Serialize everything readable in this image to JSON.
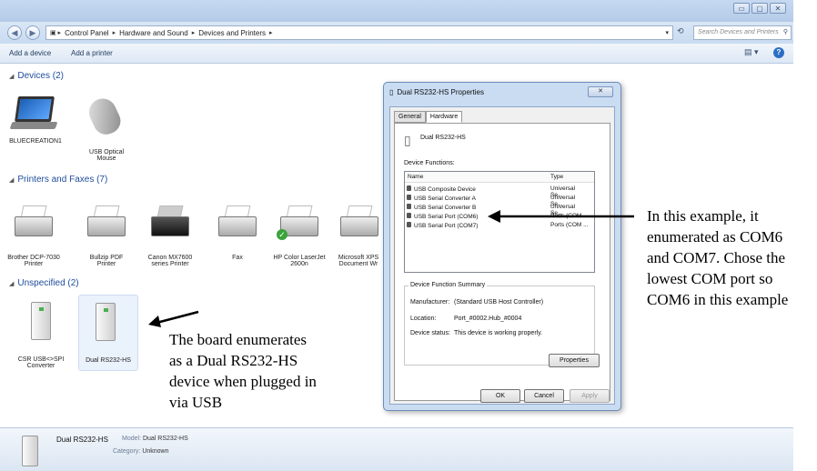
{
  "window": {
    "minimize": "▭",
    "maximize": "▢",
    "close": "✕"
  },
  "address": {
    "crumbs": [
      "Control Panel",
      "Hardware and Sound",
      "Devices and Printers"
    ],
    "search_placeholder": "Search Devices and Printers"
  },
  "toolbar": {
    "add_device": "Add a device",
    "add_printer": "Add a printer"
  },
  "sections": {
    "devices": "Devices (2)",
    "printers": "Printers and Faxes (7)",
    "unspecified": "Unspecified (2)"
  },
  "devices": [
    {
      "label": "BLUECREATION1",
      "icon": "laptop-icon"
    },
    {
      "label": "USB Optical Mouse",
      "icon": "mouse-icon"
    }
  ],
  "printers": [
    {
      "label": "Brother DCP-7030 Printer",
      "icon": "printer-icon"
    },
    {
      "label": "Bullzip PDF Printer",
      "icon": "printer-icon"
    },
    {
      "label": "Canon MX7600 series Printer",
      "icon": "printer-icon"
    },
    {
      "label": "Fax",
      "icon": "fax-icon"
    },
    {
      "label": "HP Color LaserJet 2600n",
      "icon": "printer-icon"
    },
    {
      "label": "Microsoft XPS Document Wr",
      "icon": "printer-icon"
    }
  ],
  "unspecified": [
    {
      "label": "CSR USB<>SPI Converter",
      "icon": "device-tower-icon"
    },
    {
      "label": "Dual RS232-HS",
      "icon": "device-tower-icon"
    }
  ],
  "dialog": {
    "title": "Dual RS232-HS Properties",
    "close": "✕",
    "tabs": [
      "General",
      "Hardware"
    ],
    "device_name": "Dual RS232-HS",
    "functions_label": "Device Functions:",
    "columns": [
      "Name",
      "Type"
    ],
    "functions": [
      {
        "name": "USB Composite Device",
        "type": "Universal Se..."
      },
      {
        "name": "USB Serial Converter A",
        "type": "Universal Se..."
      },
      {
        "name": "USB Serial Converter B",
        "type": "Universal Se..."
      },
      {
        "name": "USB Serial Port (COM6)",
        "type": "Ports (COM ..."
      },
      {
        "name": "USB Serial Port (COM7)",
        "type": "Ports (COM ..."
      }
    ],
    "summary_label": "Device Function Summary",
    "manufacturer_label": "Manufacturer:",
    "manufacturer": "(Standard USB Host Controller)",
    "location_label": "Location:",
    "location": "Port_#0002.Hub_#0004",
    "status_label": "Device status:",
    "status": "This device is working properly.",
    "properties_btn": "Properties",
    "ok_btn": "OK",
    "cancel_btn": "Cancel",
    "apply_btn": "Apply"
  },
  "annotations": {
    "board": "The board enumerates\nas a Dual RS232-HS\ndevice when plugged in\nvia USB",
    "com": "In this example, it\nenumerated as COM6\nand COM7. Chose the\nlowest COM port so\nCOM6 in this example"
  },
  "details": {
    "name": "Dual RS232-HS",
    "model_label": "Model:",
    "model": "Dual RS232-HS",
    "category_label": "Category:",
    "category": "Unknown"
  }
}
